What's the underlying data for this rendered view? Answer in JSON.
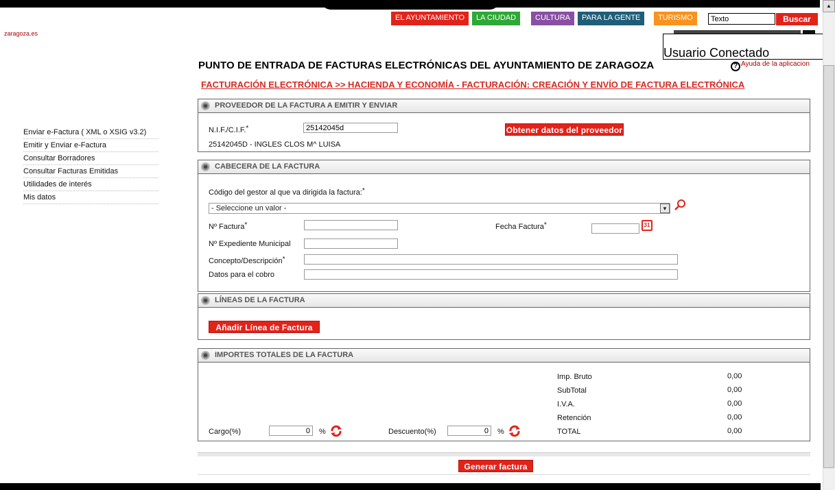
{
  "header": {
    "nav": [
      {
        "label": "EL AYUNTAMIENTO",
        "color": "#e2231a"
      },
      {
        "label": "LA CIUDAD",
        "color": "#2ea836"
      },
      {
        "label": "CULTURA",
        "color": "#8a4fa3"
      },
      {
        "label": "PARA LA GENTE",
        "color": "#1f5e78"
      },
      {
        "label": "TURISMO",
        "color": "#f7931e"
      }
    ],
    "search_value": "Texto",
    "search_button": "Buscar",
    "site_link": "zaragoza.es",
    "user_status": "Usuario Conectado",
    "help_icon": "?",
    "help_link": "Ayuda de la aplicacion"
  },
  "page": {
    "title": "PUNTO DE ENTRADA DE FACTURAS ELECTRÓNICAS DEL AYUNTAMIENTO DE ZARAGOZA",
    "breadcrumb": "FACTURACIÓN ELECTRÓNICA >> HACIENDA Y ECONOMÍA - FACTURACIÓN: CREACIÓN Y ENVÍO DE FACTURA ELECTRÓNICA"
  },
  "sidebar": {
    "items": [
      "Enviar e-Factura ( XML o XSIG v3.2)",
      "Emitir y Enviar e-Factura",
      "Consultar Borradores",
      "Consultar Facturas Emitidas",
      "Utilidades de interés",
      "Mis datos"
    ]
  },
  "proveedor": {
    "title": "PROVEEDOR DE LA FACTURA A EMITIR Y ENVIAR",
    "nif_label": "N.I.F./C.I.F.",
    "nif_value": "25142045d",
    "button": "Obtener datos del proveedor",
    "info": "25142045D - INGLES CLOS M^ LUISA"
  },
  "cabecera": {
    "title": "CABECERA DE LA FACTURA",
    "gestor_label": "Código del gestor al que va dirigida la factura:",
    "gestor_value": "- Seleccione un valor -",
    "num_factura_label": "Nº Factura",
    "fecha_label": "Fecha Factura",
    "calendar_text": "31",
    "expediente_label": "Nº Expediente Municipal",
    "concepto_label": "Concepto/Descripción",
    "cobro_label": "Datos para el cobro"
  },
  "lineas": {
    "title": "LÍNEAS DE LA FACTURA",
    "button": "Añadir Línea de Factura"
  },
  "importes": {
    "title": "IMPORTES TOTALES DE LA FACTURA",
    "rows": [
      {
        "label": "Imp. Bruto",
        "value": "0,00"
      },
      {
        "label": "SubTotal",
        "value": "0,00"
      },
      {
        "label": "I.V.A.",
        "value": "0,00"
      },
      {
        "label": "Retención",
        "value": "0,00"
      },
      {
        "label": "TOTAL",
        "value": "0,00"
      }
    ],
    "cargo_label": "Cargo(%)",
    "cargo_value": "0",
    "descuento_label": "Descuento(%)",
    "descuento_value": "0",
    "percent": "%"
  },
  "actions": {
    "generate": "Generar factura"
  }
}
